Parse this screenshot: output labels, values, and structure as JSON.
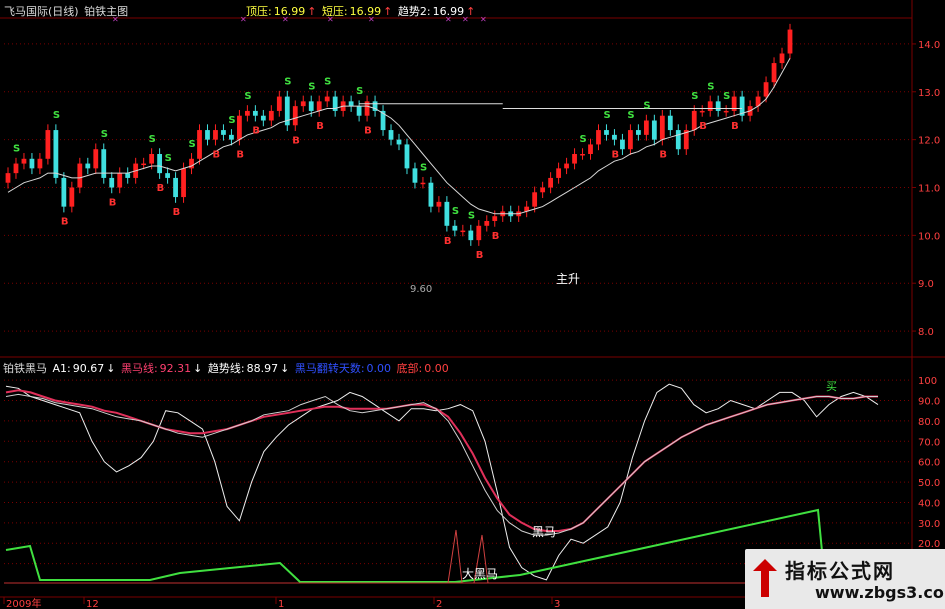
{
  "header_top": {
    "stock": "飞马国际(日线)",
    "indicator": "铂铁主图",
    "resist_label": "顶压:",
    "resist_value": "16.99",
    "short_label": "短压:",
    "short_value": "16.99",
    "trend_label": "趋势2:",
    "trend_value": "16.99",
    "arrow": "↑"
  },
  "header_bottom": {
    "indicator": "铂铁黑马",
    "a1_label": "A1:",
    "a1_value": "90.67",
    "heima_label": "黑马线:",
    "heima_value": "92.31",
    "trend_label": "趋势线:",
    "trend_value": "88.97",
    "blue_label": "黑马翻转天数:",
    "blue_value": "0.00",
    "bottom_label": "底部:",
    "bottom_value": "0.00",
    "down_arrow": "↓"
  },
  "annotations": {
    "zhusheng": "主升",
    "heima": "黑马",
    "daheima": "大黑马",
    "low_price": "9.60",
    "sell_mark": "S",
    "buy_mark": "B",
    "green_top": "买"
  },
  "x_labels": [
    "2009年",
    "12",
    "1",
    "2",
    "3"
  ],
  "colors": {
    "up": "#ff2020",
    "down": "#40e0e0",
    "grid": "#7a0000",
    "heima_line": "#e0305a",
    "green_line": "#40e040",
    "white_line": "#e8e8e8",
    "blue_text": "#3050ff"
  },
  "watermark": {
    "title": "指标公式网",
    "url": "www.zbgs3.com"
  },
  "chart_data": [
    {
      "type": "candlestick",
      "yaxis_ticks": [
        14.0,
        13.0,
        12.0,
        11.0,
        10.0,
        9.0,
        8.0
      ],
      "ylim": [
        7.5,
        14.5
      ],
      "close": [
        11.3,
        11.5,
        11.6,
        11.4,
        11.6,
        12.2,
        11.2,
        10.6,
        11.0,
        11.5,
        11.4,
        11.8,
        11.2,
        11.0,
        11.3,
        11.2,
        11.5,
        11.5,
        11.7,
        11.3,
        11.2,
        10.8,
        11.4,
        11.6,
        12.2,
        12.0,
        12.2,
        12.1,
        12.0,
        12.5,
        12.6,
        12.5,
        12.4,
        12.6,
        12.9,
        12.3,
        12.7,
        12.8,
        12.6,
        12.8,
        12.9,
        12.6,
        12.8,
        12.7,
        12.5,
        12.8,
        12.6,
        12.2,
        12.0,
        11.9,
        11.4,
        11.1,
        11.1,
        10.6,
        10.7,
        10.2,
        10.1,
        10.1,
        9.9,
        10.2,
        10.3,
        10.4,
        10.5,
        10.4,
        10.5,
        10.6,
        10.9,
        11.0,
        11.2,
        11.4,
        11.5,
        11.7,
        11.7,
        11.9,
        12.2,
        12.1,
        12.0,
        11.8,
        12.2,
        12.1,
        12.4,
        12.0,
        12.5,
        12.2,
        11.8,
        12.2,
        12.6,
        12.6,
        12.8,
        12.6,
        12.6,
        12.9,
        12.5,
        12.7,
        12.9,
        13.2,
        13.6,
        13.8,
        14.3
      ],
      "open": [
        11.1,
        11.3,
        11.5,
        11.6,
        11.4,
        11.6,
        12.2,
        11.2,
        10.6,
        11.0,
        11.5,
        11.4,
        11.8,
        11.2,
        11.0,
        11.3,
        11.2,
        11.5,
        11.5,
        11.7,
        11.3,
        11.2,
        10.8,
        11.4,
        11.6,
        12.2,
        12.0,
        12.2,
        12.1,
        12.0,
        12.5,
        12.6,
        12.5,
        12.4,
        12.6,
        12.9,
        12.3,
        12.7,
        12.8,
        12.6,
        12.8,
        12.9,
        12.6,
        12.8,
        12.7,
        12.5,
        12.8,
        12.6,
        12.2,
        12.0,
        11.9,
        11.4,
        11.1,
        11.1,
        10.6,
        10.7,
        10.2,
        10.1,
        10.1,
        9.9,
        10.2,
        10.3,
        10.4,
        10.5,
        10.4,
        10.5,
        10.6,
        10.9,
        11.0,
        11.2,
        11.4,
        11.5,
        11.7,
        11.7,
        11.9,
        12.2,
        12.1,
        12.0,
        11.8,
        12.2,
        12.1,
        12.4,
        12.0,
        12.5,
        12.2,
        11.8,
        12.2,
        12.6,
        12.6,
        12.8,
        12.6,
        12.6,
        12.9,
        12.5,
        12.7,
        12.9,
        13.2,
        13.6,
        13.8
      ],
      "ma_slow": [
        10.9,
        11.0,
        11.1,
        11.15,
        11.2,
        11.3,
        11.3,
        11.25,
        11.2,
        11.2,
        11.25,
        11.3,
        11.3,
        11.3,
        11.3,
        11.3,
        11.35,
        11.4,
        11.45,
        11.45,
        11.4,
        11.35,
        11.4,
        11.45,
        11.55,
        11.65,
        11.75,
        11.85,
        11.9,
        12.0,
        12.1,
        12.15,
        12.2,
        12.25,
        12.35,
        12.4,
        12.45,
        12.5,
        12.55,
        12.6,
        12.65,
        12.65,
        12.7,
        12.7,
        12.7,
        12.7,
        12.65,
        12.55,
        12.45,
        12.3,
        12.1,
        11.9,
        11.7,
        11.5,
        11.3,
        11.1,
        10.95,
        10.8,
        10.65,
        10.55,
        10.5,
        10.45,
        10.45,
        10.45,
        10.45,
        10.5,
        10.55,
        10.6,
        10.7,
        10.8,
        10.9,
        11.0,
        11.1,
        11.2,
        11.35,
        11.45,
        11.55,
        11.6,
        11.7,
        11.75,
        11.85,
        11.9,
        12.0,
        12.05,
        12.1,
        12.15,
        12.2,
        12.3,
        12.35,
        12.4,
        12.45,
        12.5,
        12.55,
        12.6,
        12.7,
        12.85,
        13.1,
        13.4,
        13.7
      ]
    },
    {
      "type": "line",
      "yaxis_ticks": [
        100,
        90.0,
        80.0,
        70.0,
        60.0,
        50.0,
        40.0,
        30.0,
        20.0,
        10.0
      ],
      "ylim": [
        0,
        104
      ],
      "series": [
        {
          "name": "A1",
          "values": [
            97,
            96,
            92,
            90,
            88,
            86,
            84,
            70,
            60,
            55,
            58,
            62,
            70,
            85,
            84,
            80,
            76,
            60,
            38,
            31,
            50,
            65,
            72,
            78,
            82,
            86,
            88,
            90,
            94,
            92,
            88,
            84,
            80,
            86,
            86,
            85,
            86,
            88,
            85,
            70,
            45,
            18,
            8,
            4,
            2,
            14,
            22,
            20,
            24,
            28,
            40,
            62,
            80,
            94,
            98,
            96,
            88,
            84,
            86,
            90,
            88,
            86,
            90,
            94,
            94,
            90,
            82,
            88,
            92,
            94,
            92,
            88
          ]
        },
        {
          "name": "黑马线",
          "values": [
            94,
            95,
            94,
            92,
            90,
            89,
            88,
            87,
            85,
            84,
            82,
            80,
            78,
            76,
            75,
            74,
            74,
            75,
            76,
            78,
            80,
            82,
            83,
            84,
            85,
            86,
            87,
            87,
            86,
            86,
            86,
            86,
            87,
            88,
            88,
            86,
            82,
            74,
            64,
            52,
            42,
            34,
            30,
            27,
            26,
            26,
            27,
            30,
            36,
            42,
            48,
            54,
            60,
            64,
            68,
            72,
            75,
            78,
            80,
            82,
            84,
            86,
            88,
            89,
            90,
            91,
            92,
            92,
            91,
            91,
            92,
            92
          ]
        },
        {
          "name": "趋势线",
          "values": [
            92,
            93,
            92,
            91,
            89,
            88,
            87,
            86,
            84,
            82,
            81,
            80,
            78,
            76,
            74,
            73,
            72,
            74,
            76,
            78,
            80,
            83,
            84,
            85,
            88,
            90,
            92,
            88,
            85,
            84,
            85,
            86,
            87,
            88,
            89,
            86,
            80,
            70,
            58,
            46,
            36,
            30,
            26,
            24,
            24,
            25,
            27,
            30,
            36,
            42,
            48,
            54,
            60,
            64,
            68,
            72,
            75,
            78,
            80,
            82,
            84,
            86,
            88,
            89,
            90,
            91,
            92,
            92,
            91,
            91,
            92,
            92
          ]
        }
      ]
    }
  ]
}
